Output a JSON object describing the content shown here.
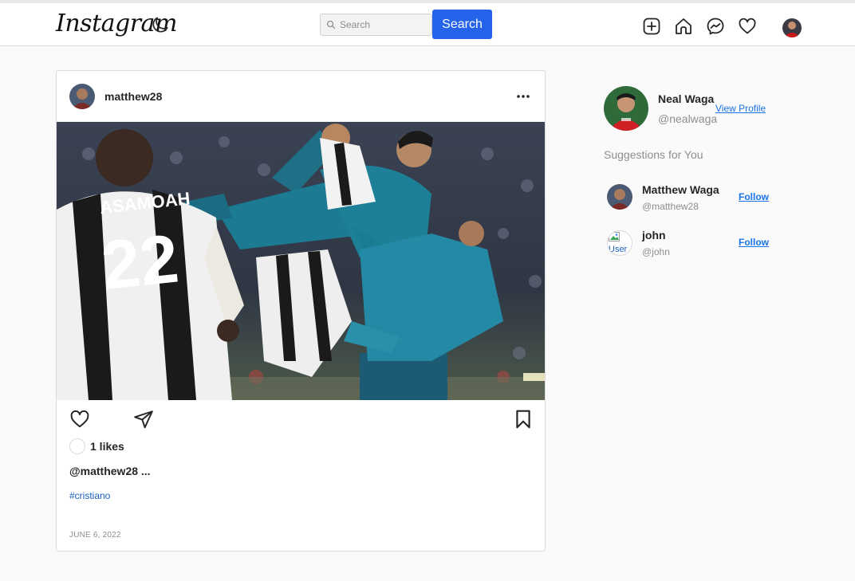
{
  "navbar": {
    "logo": "Instagram",
    "search_placeholder": "Search",
    "search_button": "Search",
    "icons": [
      "moon-icon",
      "add-post-icon",
      "home-icon",
      "messenger-icon",
      "heart-icon",
      "profile-avatar"
    ]
  },
  "post": {
    "username": "matthew28",
    "likes": "1 likes",
    "caption": "@matthew28 ...",
    "hashtag": "#cristiano",
    "date": "JUNE 6, 2022"
  },
  "sidebar": {
    "profile_name": "Neal Waga",
    "profile_handle": "@nealwaga",
    "view_profile": "View Profile",
    "suggestions_title": "Suggestions for You",
    "suggestions": [
      {
        "name": "Matthew Waga",
        "handle": "@matthew28",
        "follow": "Follow"
      },
      {
        "name": "john",
        "handle": "@john",
        "follow": "Follow",
        "avatar_alt": "User"
      }
    ]
  },
  "colors": {
    "accent": "#2563eb",
    "link": "#1a73e8",
    "border": "#dbdbdb",
    "muted": "#8e8e8e"
  }
}
